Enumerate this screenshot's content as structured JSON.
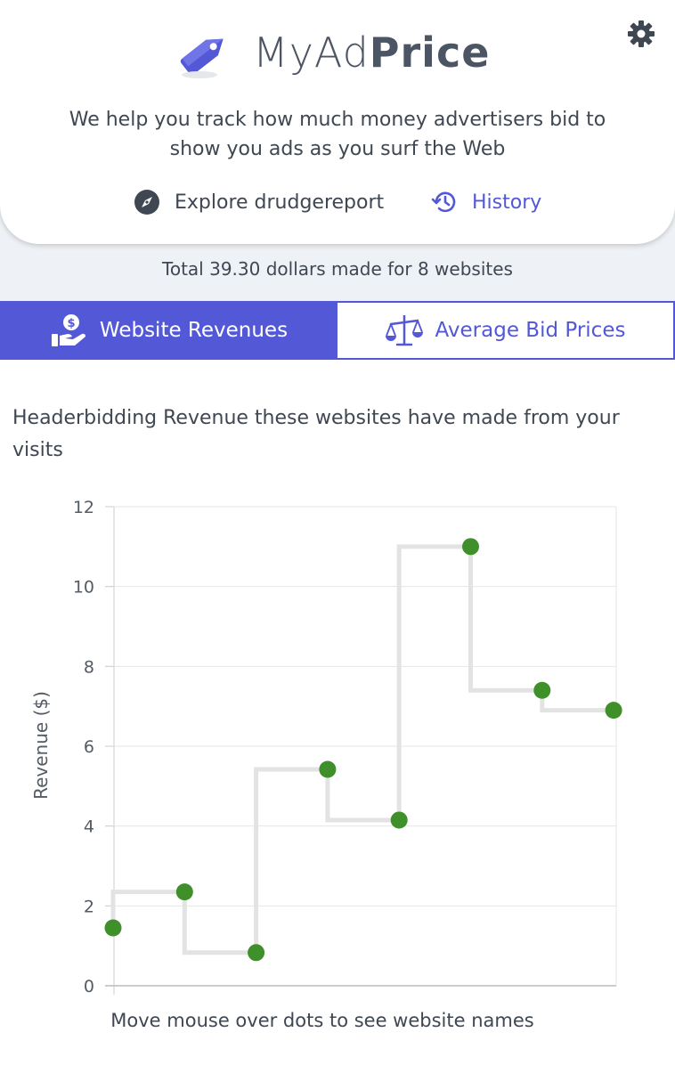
{
  "app": {
    "logo_light": "MyAd",
    "logo_bold": "Price",
    "tagline": "We help you track how much money advertisers bid to show you ads as you surf the Web"
  },
  "nav": {
    "explore_label": "Explore drudgereport",
    "history_label": "History"
  },
  "summary": {
    "total_text": "Total 39.30 dollars made for 8 websites"
  },
  "tabs": [
    {
      "label": "Website Revenues",
      "active": true
    },
    {
      "label": "Average Bid Prices",
      "active": false
    }
  ],
  "chart_heading": "Headerbidding Revenue these websites have made from your visits",
  "chart_note": "Move mouse over dots to see website names",
  "colors": {
    "accent": "#5258d6",
    "point": "#3f8f2b",
    "step_line": "#e3e3e3"
  },
  "icons": {
    "logo": "price-tag-icon",
    "settings": "gear-icon",
    "explore": "compass-icon",
    "history": "history-clock-icon",
    "revenues": "hand-dollar-icon",
    "bids": "balance-scale-icon"
  },
  "chart_data": {
    "type": "scatter",
    "title": "",
    "xlabel": "",
    "ylabel": "Revenue ($)",
    "ylim": [
      0,
      12
    ],
    "yticks": [
      "0",
      "2",
      "4",
      "6",
      "8",
      "10",
      "12"
    ],
    "grid": true,
    "step_line": true,
    "x": [
      1,
      2,
      3,
      4,
      5,
      6,
      7,
      8
    ],
    "values": [
      1.45,
      2.35,
      0.83,
      5.42,
      4.15,
      11.0,
      7.4,
      6.9
    ]
  }
}
